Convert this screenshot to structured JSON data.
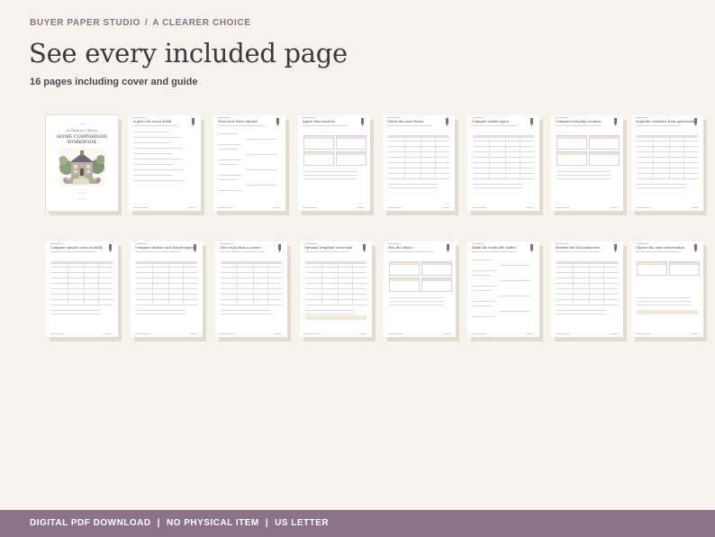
{
  "breadcrumb": {
    "brand": "BUYER PAPER STUDIO",
    "separator": "/",
    "section": "A CLEARER CHOICE"
  },
  "title": "See every included page",
  "subtitle": "16 pages including cover and guide",
  "cover": {
    "brand": "A Clearer Choice",
    "title_line1": "HOME COMPARISON",
    "title_line2": "WORKBOOK"
  },
  "pages": [
    "A place for every detail",
    "Meet your three options",
    "Agree what matters",
    "Check the must-haves",
    "Compare usable space",
    "Compare everyday routines",
    "Separate condition from guesswork",
    "Compare special costs carefully",
    "Compare outdoor and shared space",
    "Give each claim a source",
    "Optional weighted scorecard",
    "Test the choice",
    "Make the trade-offs visible",
    "Resolve the last unknowns",
    "Choose the next conversation"
  ],
  "footer": {
    "item1": "DIGITAL PDF DOWNLOAD",
    "item2": "NO PHYSICAL ITEM",
    "item3": "US LETTER",
    "separator": "|"
  },
  "colors": {
    "accent": "#8d7389",
    "background": "#f6f3ec",
    "heading": "#3b3a40"
  }
}
